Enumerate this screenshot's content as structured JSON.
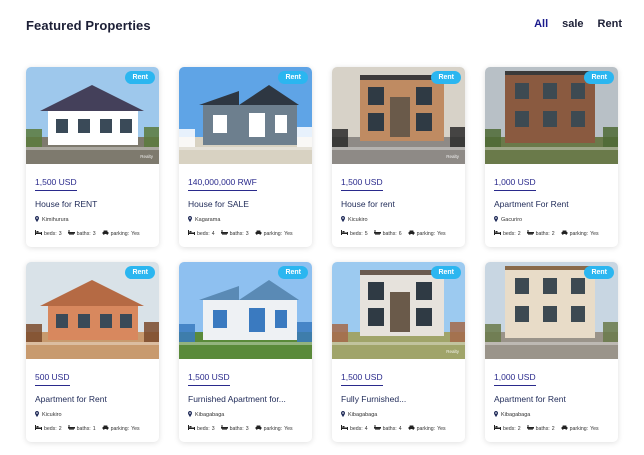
{
  "section_title": "Featured Properties",
  "filters": [
    {
      "label": "All",
      "active": true
    },
    {
      "label": "sale",
      "active": false
    },
    {
      "label": "Rent",
      "active": false
    }
  ],
  "feature_labels": {
    "beds": "beds:",
    "baths": "baths:",
    "parking": "parking:"
  },
  "watermark": "Realty",
  "properties": [
    {
      "badge": "Rent",
      "price": "1,500 USD",
      "title": "House for RENT",
      "location": "Kimihurura",
      "beds": "3",
      "baths": "3",
      "parking": "Yes",
      "scene": {
        "sky": "#9ec8ec",
        "wall": "#ffffff",
        "roof": "#44405a",
        "ground": "#7e7a6e",
        "accent": "#5a7a3c"
      },
      "watermark": true
    },
    {
      "badge": "Rent",
      "price": "140,000,000 RWF",
      "title": "House for SALE",
      "location": "Kagarama",
      "beds": "4",
      "baths": "3",
      "parking": "Yes",
      "scene": {
        "sky": "#5fa4e6",
        "wall": "#6d7f8e",
        "roof": "#2e3742",
        "ground": "#d8d2c2",
        "accent": "#ffffff"
      },
      "watermark": false
    },
    {
      "badge": "Rent",
      "price": "1,500 USD",
      "title": "House for rent",
      "location": "Kicukiro",
      "beds": "5",
      "baths": "6",
      "parking": "Yes",
      "scene": {
        "sky": "#d7d2c8",
        "wall": "#bf8b62",
        "roof": "#3c3a3a",
        "ground": "#8e8a86",
        "accent": "#2c2c2c"
      },
      "watermark": true
    },
    {
      "badge": "Rent",
      "price": "1,000 USD",
      "title": "Apartment For Rent",
      "location": "Gacuriro",
      "beds": "2",
      "baths": "2",
      "parking": "Yes",
      "scene": {
        "sky": "#b8c0c6",
        "wall": "#8a5a40",
        "roof": "#3a3a3a",
        "ground": "#6a7a4a",
        "accent": "#4d6a35"
      },
      "watermark": false
    },
    {
      "badge": "Rent",
      "price": "500 USD",
      "title": "Apartment for Rent",
      "location": "Kicukiro",
      "beds": "2",
      "baths": "1",
      "parking": "Yes",
      "scene": {
        "sky": "#d9e2e8",
        "wall": "#d8885e",
        "roof": "#b56a44",
        "ground": "#c89a6e",
        "accent": "#7a4a2c"
      },
      "watermark": false
    },
    {
      "badge": "Rent",
      "price": "1,500 USD",
      "title": "Furnished Apartment for...",
      "location": "Kibagabaga",
      "beds": "3",
      "baths": "3",
      "parking": "Yes",
      "scene": {
        "sky": "#8ec0f0",
        "wall": "#eef1f4",
        "roof": "#5a8ab5",
        "ground": "#5a8a3a",
        "accent": "#3a7ac0"
      },
      "watermark": false
    },
    {
      "badge": "Rent",
      "price": "1,500 USD",
      "title": "Fully Furnished...",
      "location": "Kibagabaga",
      "beds": "4",
      "baths": "4",
      "parking": "Yes",
      "scene": {
        "sky": "#9ccaf0",
        "wall": "#e6e2dc",
        "roof": "#6a5a4e",
        "ground": "#a0a46a",
        "accent": "#a56a4a"
      },
      "watermark": true
    },
    {
      "badge": "Rent",
      "price": "1,000 USD",
      "title": "Apartment for Rent",
      "location": "Kibagabaga",
      "beds": "2",
      "baths": "2",
      "parking": "Yes",
      "scene": {
        "sky": "#c8d6e2",
        "wall": "#e8dcc8",
        "roof": "#8a6a4a",
        "ground": "#9a948a",
        "accent": "#6a7a4a"
      },
      "watermark": false
    }
  ]
}
